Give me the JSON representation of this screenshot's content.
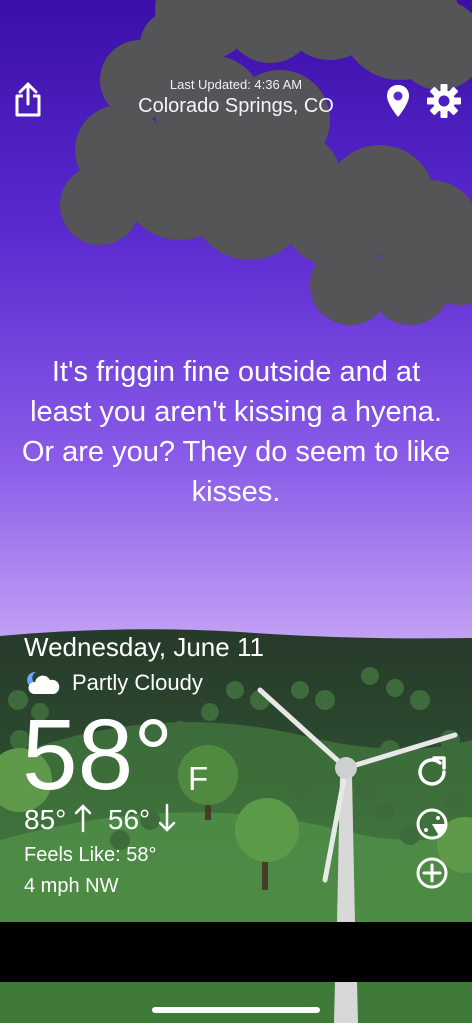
{
  "header": {
    "last_updated_label": "Last Updated: 4:36 AM",
    "location": "Colorado Springs, CO"
  },
  "message": "It's friggin fine outside and at least you aren't kissing a hyena. Or are you? They do seem to like kisses.",
  "weather": {
    "date": "Wednesday, June 11",
    "condition": "Partly Cloudy",
    "temperature": "58",
    "degree_symbol": "°",
    "unit": "F",
    "high": "85°",
    "low": "56°",
    "feels_like": "Feels Like: 58°",
    "wind": "4 mph NW"
  },
  "icons": {
    "share": "share-icon",
    "location": "location-pin-icon",
    "settings": "gear-icon",
    "condition": "partly-cloudy-icon",
    "refresh": "refresh-icon",
    "radar": "radar-icon",
    "add": "plus-circle-icon",
    "up": "arrow-up-icon",
    "down": "arrow-down-icon"
  },
  "colors": {
    "sky_top": "#3a0fa8",
    "sky_mid": "#6f3ee0",
    "sky_bottom": "#c6a8f5",
    "cloud": "#555457",
    "ground": "#2f4a32",
    "black_band": "#000000"
  }
}
